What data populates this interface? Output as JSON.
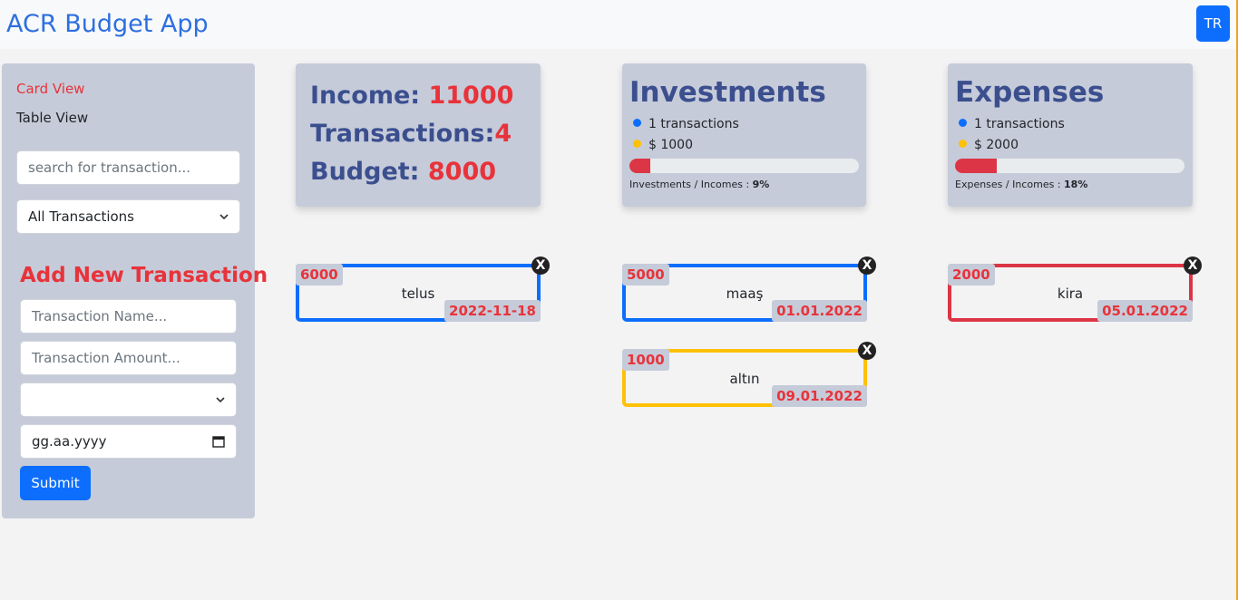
{
  "header": {
    "brand": "ACR Budget App",
    "lang_button": "TR"
  },
  "sidebar": {
    "card_view": "Card View",
    "table_view": "Table View",
    "search_placeholder": "search for transaction...",
    "filter_selected": "All Transactions",
    "add_title": "Add New Transaction",
    "name_placeholder": "Transaction Name...",
    "amount_placeholder": "Transaction Amount...",
    "type_selected": "",
    "date_placeholder": "gg.aa.yyyy",
    "submit_label": "Submit"
  },
  "summary": {
    "income_label": "Income: ",
    "income_value": "11000",
    "transactions_label": "Transactions:",
    "transactions_value": "4",
    "budget_label": "Budget: ",
    "budget_value": "8000"
  },
  "investments": {
    "title": "Investments",
    "count_text": "1 transactions",
    "amount_text": "$ 1000",
    "ratio_label": "Investments / Incomes : ",
    "ratio_value": "9%",
    "progress_fraction": 0.09
  },
  "expenses": {
    "title": "Expenses",
    "count_text": "1 transactions",
    "amount_text": "$ 2000",
    "ratio_label": "Expenses / Incomes : ",
    "ratio_value": "18%",
    "progress_fraction": 0.18
  },
  "colors": {
    "income": "#0d6efd",
    "investment": "#ffc107",
    "expense": "#dc3545",
    "accent_red": "#e8333a"
  },
  "transactions": [
    {
      "amount": "6000",
      "name": "telus",
      "date": "2022-11-18",
      "close": "X",
      "kind": "income"
    },
    {
      "amount": "5000",
      "name": "maaş",
      "date": "01.01.2022",
      "close": "X",
      "kind": "income"
    },
    {
      "amount": "2000",
      "name": "kira",
      "date": "05.01.2022",
      "close": "X",
      "kind": "expense"
    },
    {
      "amount": "1000",
      "name": "altın",
      "date": "09.01.2022",
      "close": "X",
      "kind": "investment"
    }
  ]
}
